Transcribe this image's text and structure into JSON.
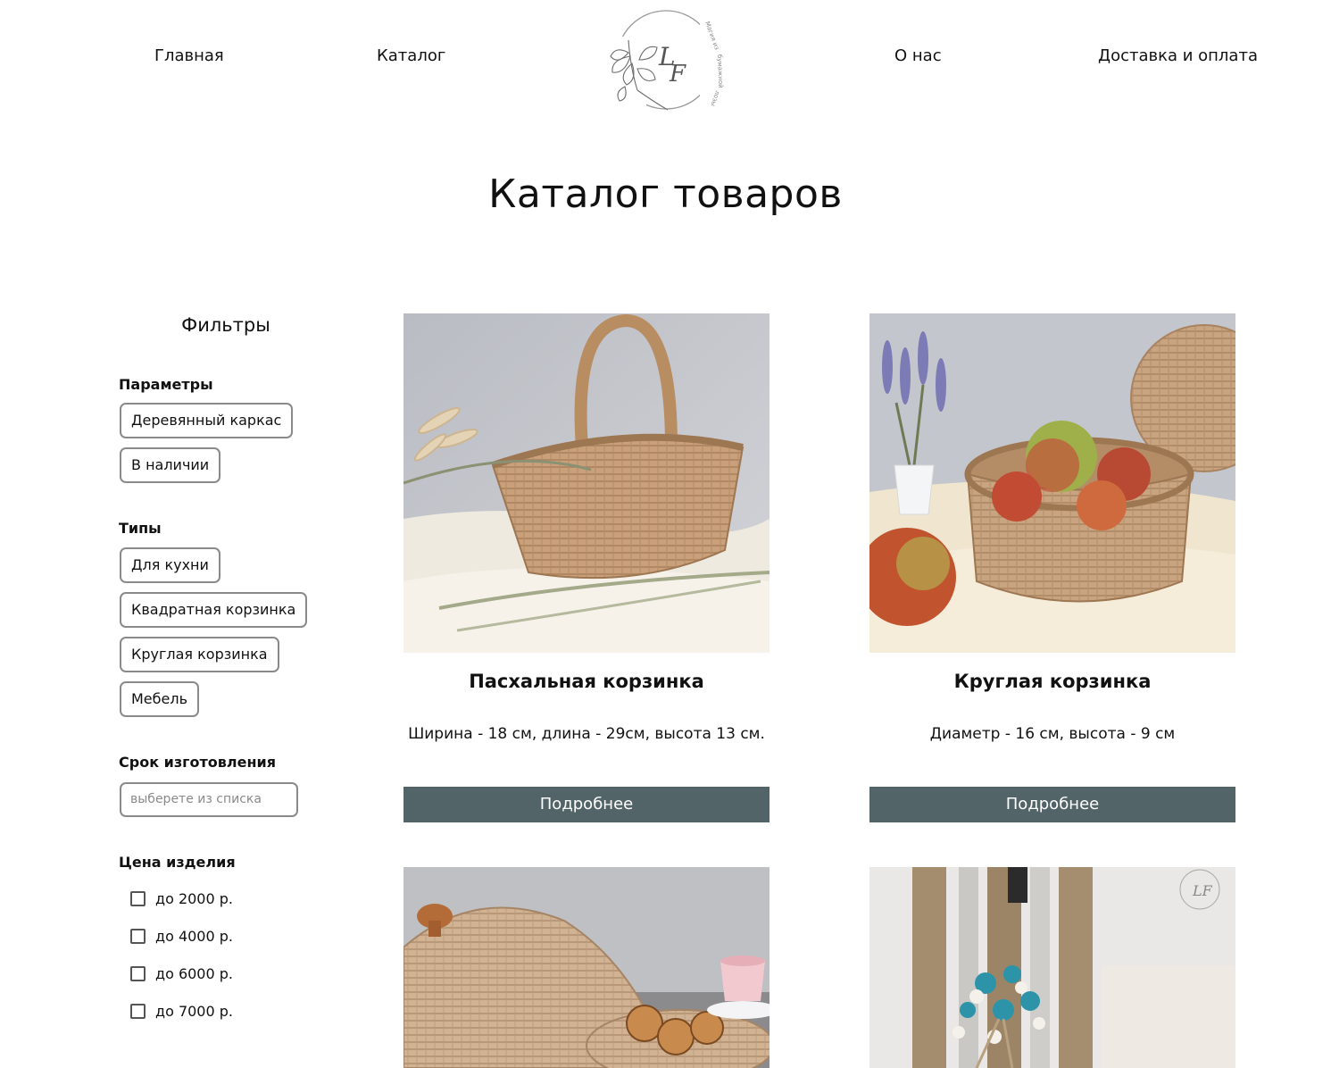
{
  "nav": {
    "home": "Главная",
    "catalog": "Каталог",
    "about": "О нас",
    "delivery": "Доставка и оплата"
  },
  "logo": {
    "monogram": "LF",
    "ring_text": "Магия из бумажной лозы",
    "icon": "ginkgo-leaf-icon"
  },
  "page": {
    "title": "Каталог товаров"
  },
  "filters": {
    "title": "Фильтры",
    "params": {
      "title": "Параметры",
      "items": [
        "Деревянный каркас",
        "В наличии"
      ]
    },
    "types": {
      "title": "Типы",
      "items": [
        "Для кухни",
        "Квадратная корзинка",
        "Круглая корзинка",
        "Мебель"
      ]
    },
    "term": {
      "title": "Срок изготовления",
      "placeholder": "выберете из списка"
    },
    "price": {
      "title": "Цена изделия",
      "options": [
        "до 2000 р.",
        "до 4000 р.",
        "до 6000 р.",
        "до 7000 р."
      ]
    }
  },
  "products": [
    {
      "title": "Пасхальная корзинка",
      "desc": "Ширина - 18 см, длина - 29см, высота 13 см.",
      "button": "Подробнее"
    },
    {
      "title": "Круглая корзинка",
      "desc": "Диаметр - 16 см, высота - 9 см",
      "button": "Подробнее"
    },
    {
      "title": "",
      "desc": "",
      "button": ""
    },
    {
      "title": "",
      "desc": "",
      "button": ""
    }
  ],
  "colors": {
    "button_bg": "#536468",
    "chip_border": "#8a8a8a",
    "wicker": "#c9a07a"
  }
}
